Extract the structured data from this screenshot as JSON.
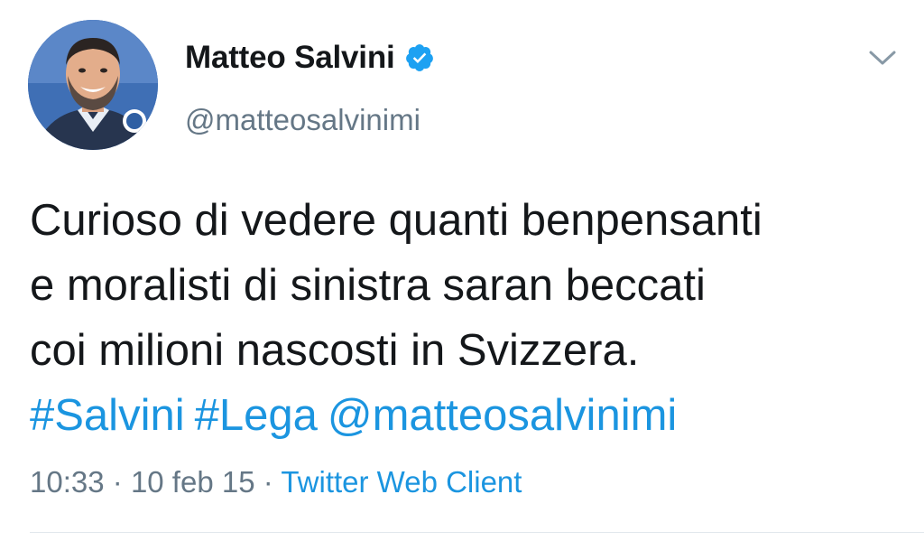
{
  "tweet": {
    "display_name": "Matteo Salvini",
    "handle": "@matteosalvinimi",
    "text_lines": [
      "Curioso di vedere quanti benpensanti",
      "e moralisti di sinistra saran beccati",
      "coi milioni nascosti in Svizzera."
    ],
    "hashtags": [
      "#Salvini",
      "#Lega"
    ],
    "mention": "@matteosalvinimi",
    "time": "10:33",
    "separator": "·",
    "date": "10 feb 15",
    "source": "Twitter Web Client"
  },
  "icons": {
    "verified": "verified-badge-icon",
    "menu": "chevron-down-icon"
  },
  "colors": {
    "link_blue": "#1b95e0",
    "verified_blue": "#1da1f2",
    "muted_gray": "#657786",
    "text_dark": "#14171a",
    "divider": "#e1e8ed"
  }
}
